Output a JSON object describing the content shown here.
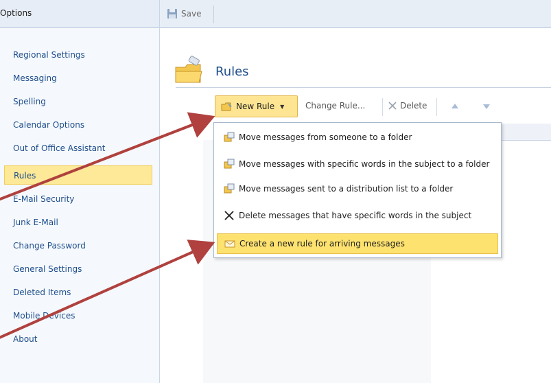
{
  "left_pane": {
    "title": "Options",
    "items": [
      {
        "label": "Regional Settings"
      },
      {
        "label": "Messaging"
      },
      {
        "label": "Spelling"
      },
      {
        "label": "Calendar Options"
      },
      {
        "label": "Out of Office Assistant"
      },
      {
        "label": "Rules",
        "selected": true
      },
      {
        "label": "E-Mail Security"
      },
      {
        "label": "Junk E-Mail"
      },
      {
        "label": "Change Password"
      },
      {
        "label": "General Settings"
      },
      {
        "label": "Deleted Items"
      },
      {
        "label": "Mobile Devices"
      },
      {
        "label": "About"
      }
    ]
  },
  "toolbar": {
    "save_label": "Save"
  },
  "page": {
    "title": "Rules"
  },
  "rules_toolbar": {
    "new_rule": "New Rule",
    "change_rule": "Change Rule...",
    "delete": "Delete"
  },
  "dropdown": {
    "items": [
      {
        "label": "Move messages from someone to a folder",
        "icon": "move-folder-icon"
      },
      {
        "label": "Move messages with specific words in the subject to a folder",
        "icon": "move-folder-icon"
      },
      {
        "label": "Move messages sent to a distribution list to a folder",
        "icon": "move-folder-icon"
      },
      {
        "label": "Delete messages that have specific words in the subject",
        "icon": "delete-x-icon"
      },
      {
        "label": "Create a new rule for arriving messages",
        "icon": "envelope-icon",
        "highlighted": true
      }
    ]
  },
  "colors": {
    "accent": "#1f4e8c",
    "highlight": "#fde270",
    "annotation_arrow": "#b0413e"
  }
}
